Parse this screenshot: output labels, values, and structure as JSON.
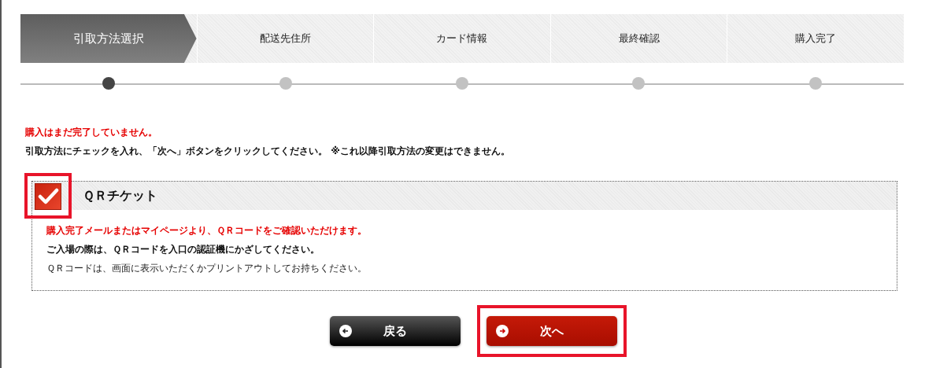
{
  "steps": [
    {
      "label": "引取方法選択",
      "selected": true
    },
    {
      "label": "配送先住所",
      "selected": false
    },
    {
      "label": "カード情報",
      "selected": false
    },
    {
      "label": "最終確認",
      "selected": false
    },
    {
      "label": "購入完了",
      "selected": false
    }
  ],
  "notice": {
    "warning": "購入はまだ完了していません。",
    "instruction": "引取方法にチェックを入れ、「次へ」ボタンをクリックしてください。 ※これ以降引取方法の変更はできません。"
  },
  "options": [
    {
      "title": "ＱＲチケット",
      "checked": true,
      "highlighted": true,
      "lines": [
        {
          "text": "購入完了メールまたはマイページより、ＱＲコードをご確認いただけます。",
          "kind": "alert"
        },
        {
          "text": "ご入場の際は、ＱＲコードを入口の認証機にかざしてください。",
          "kind": "strong"
        },
        {
          "text": "ＱＲコードは、画面に表示いただくかプリントアウトしてお持ちください。",
          "kind": "plain"
        }
      ]
    }
  ],
  "buttons": [
    {
      "label": "戻る",
      "kind": "back",
      "highlighted": false
    },
    {
      "label": "次へ",
      "kind": "next",
      "highlighted": true
    }
  ]
}
